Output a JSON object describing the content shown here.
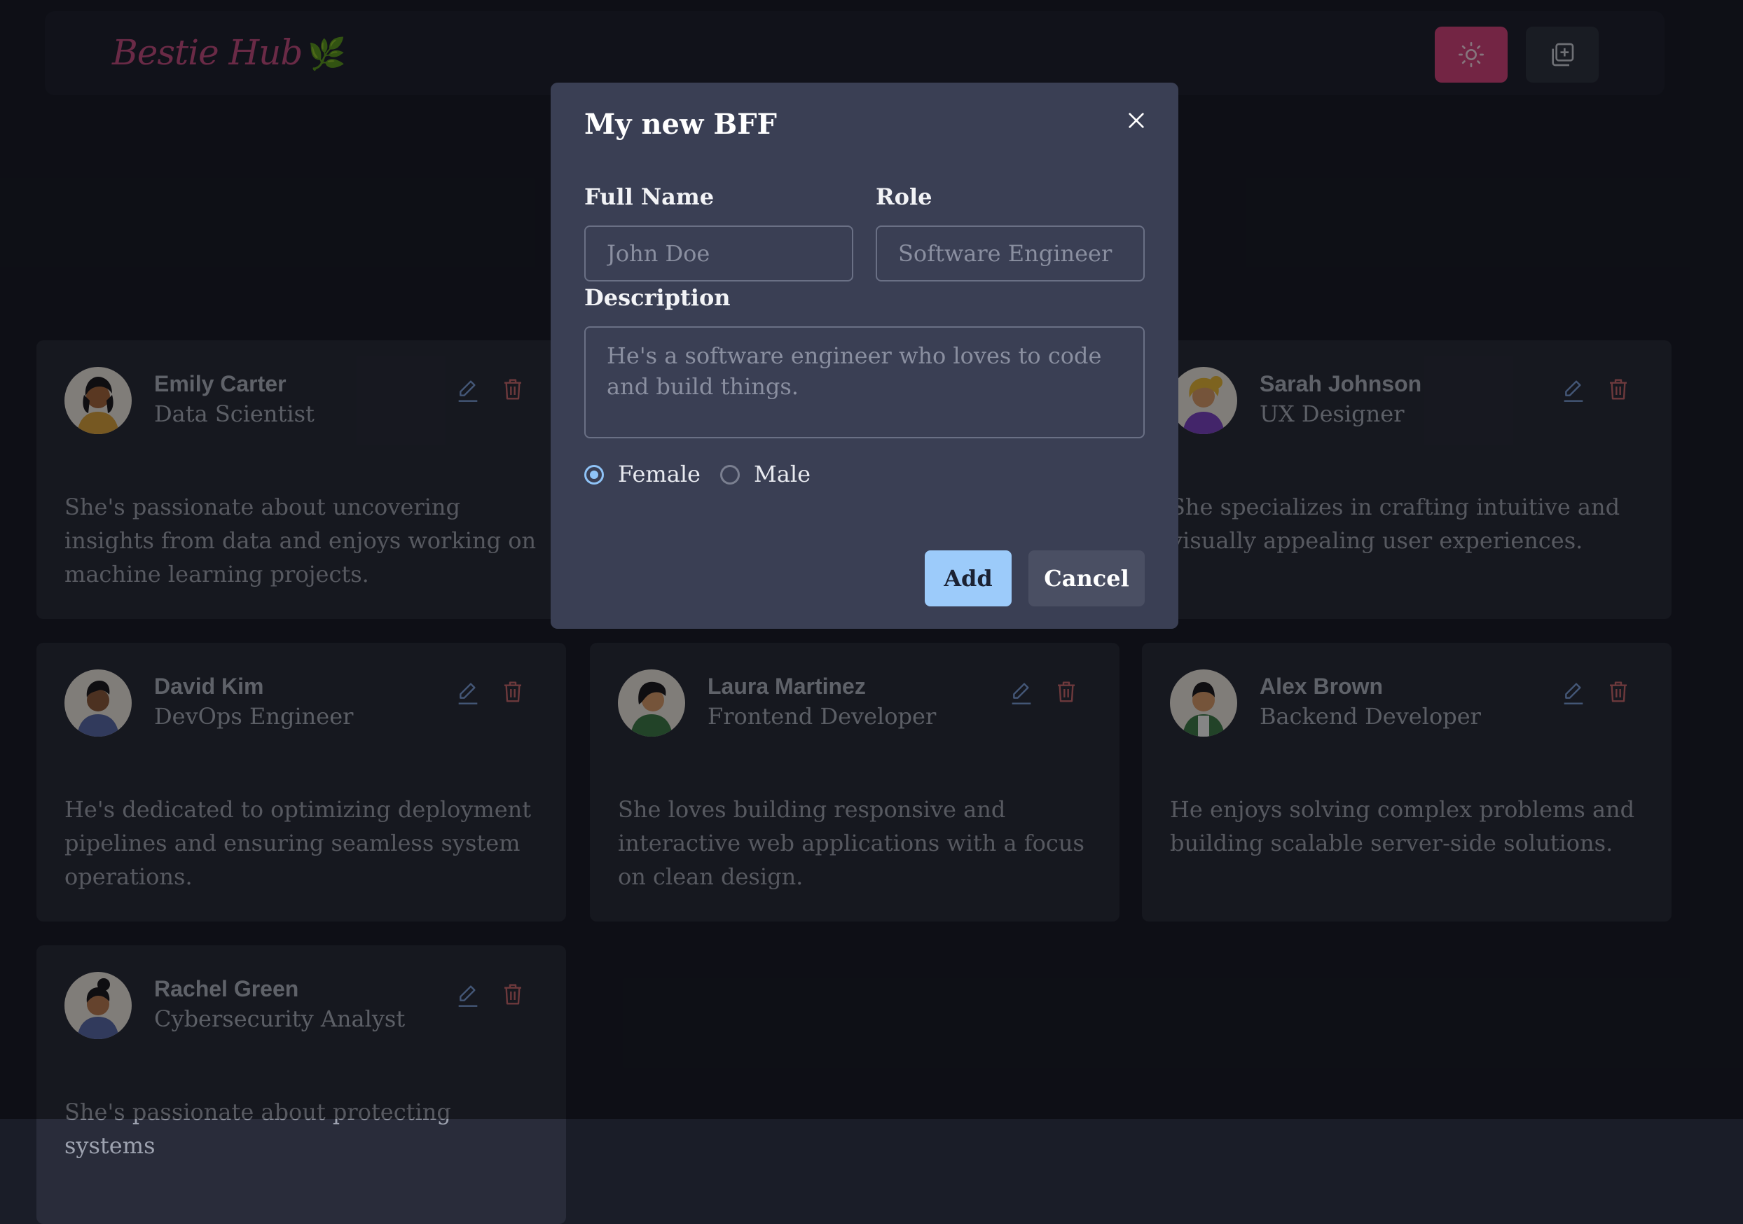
{
  "app": {
    "logo_text": "Bestie Hub",
    "logo_emoji": "🌿"
  },
  "header": {
    "theme_icon": "sun-icon",
    "add_icon": "add-stack-icon",
    "accent_color": "#d1447d"
  },
  "cards": [
    {
      "name": "Emily Carter",
      "role": "Data Scientist",
      "description": "She's passionate about uncovering insights from data and enjoys working on machine learning projects."
    },
    {
      "name": "",
      "role": "",
      "description": ""
    },
    {
      "name": "Sarah Johnson",
      "role": "UX Designer",
      "description": "She specializes in crafting intuitive and visually appealing user experiences."
    },
    {
      "name": "David Kim",
      "role": "DevOps Engineer",
      "description": "He's dedicated to optimizing deployment pipelines and ensuring seamless system operations."
    },
    {
      "name": "Laura Martinez",
      "role": "Frontend Developer",
      "description": "She loves building responsive and interactive web applications with a focus on clean design."
    },
    {
      "name": "Alex Brown",
      "role": "Backend Developer",
      "description": "He enjoys solving complex problems and building scalable server-side solutions."
    },
    {
      "name": "Rachel Green",
      "role": "Cybersecurity Analyst",
      "description": "She's passionate about protecting systems"
    }
  ],
  "modal": {
    "title": "My new BFF",
    "full_name_label": "Full Name",
    "full_name_placeholder": "John Doe",
    "role_label": "Role",
    "role_placeholder": "Software Engineer",
    "description_label": "Description",
    "description_placeholder": "He's a software engineer who loves to code and build things.",
    "gender_options": [
      "Female",
      "Male"
    ],
    "selected_gender": "Female",
    "add_label": "Add",
    "cancel_label": "Cancel"
  }
}
